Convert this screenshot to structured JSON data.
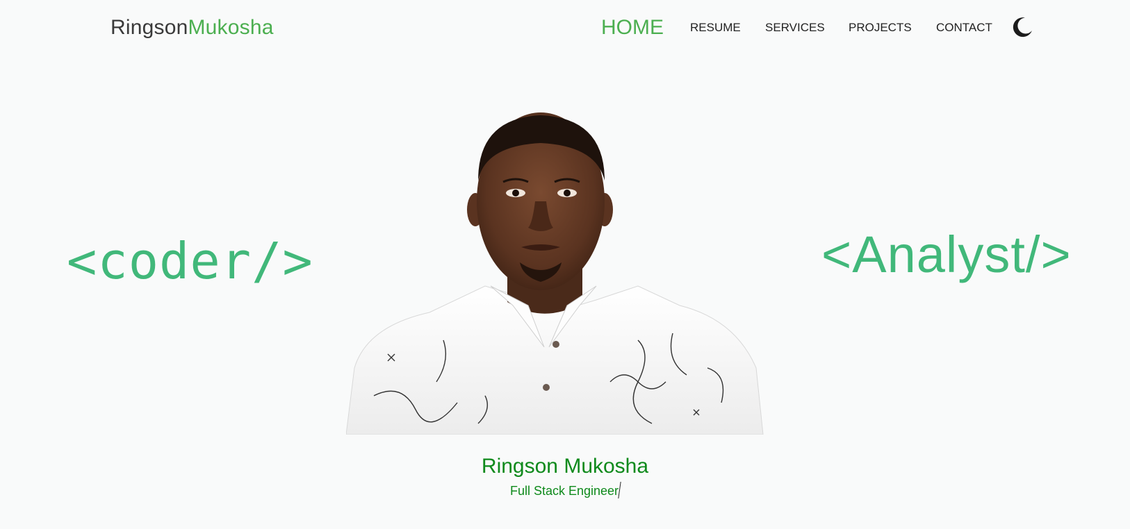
{
  "brand": {
    "first": "Ringson",
    "last": "Mukosha",
    "accent_color": "#4caf50"
  },
  "nav": {
    "items": [
      {
        "label": "HOME",
        "active": true
      },
      {
        "label": "RESUME",
        "active": false
      },
      {
        "label": "SERVICES",
        "active": false
      },
      {
        "label": "PROJECTS",
        "active": false
      },
      {
        "label": "CONTACT",
        "active": false
      }
    ],
    "theme_toggle_icon": "moon-icon"
  },
  "hero": {
    "left_tag": "<coder/>",
    "right_tag": "<Analyst/>",
    "tag_color": "#41b87a",
    "portrait": "portrait-photo",
    "name": "Ringson Mukosha",
    "role": "Full Stack Engineer",
    "caption_color": "#0f8a1c"
  }
}
